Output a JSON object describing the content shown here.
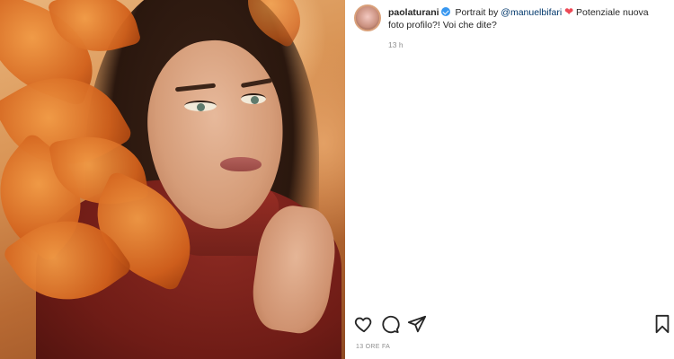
{
  "post": {
    "username": "paolaturani",
    "caption_prefix": "Portrait by ",
    "mention": "@manuelbifari",
    "caption_suffix": " Potenziale nuova foto profilo?! Voi che dite?",
    "heart_emoji": "❤",
    "time_ago": "13 h",
    "date_label": "13 ORE FA"
  },
  "icons": {
    "verified": "verified-badge-icon",
    "like": "heart-icon",
    "comment": "comment-icon",
    "share": "share-icon",
    "save": "bookmark-icon"
  },
  "colors": {
    "verified_blue": "#3897f0",
    "mention": "#00376b",
    "heart_red": "#ed4956",
    "muted_text": "#8e8e8e"
  }
}
